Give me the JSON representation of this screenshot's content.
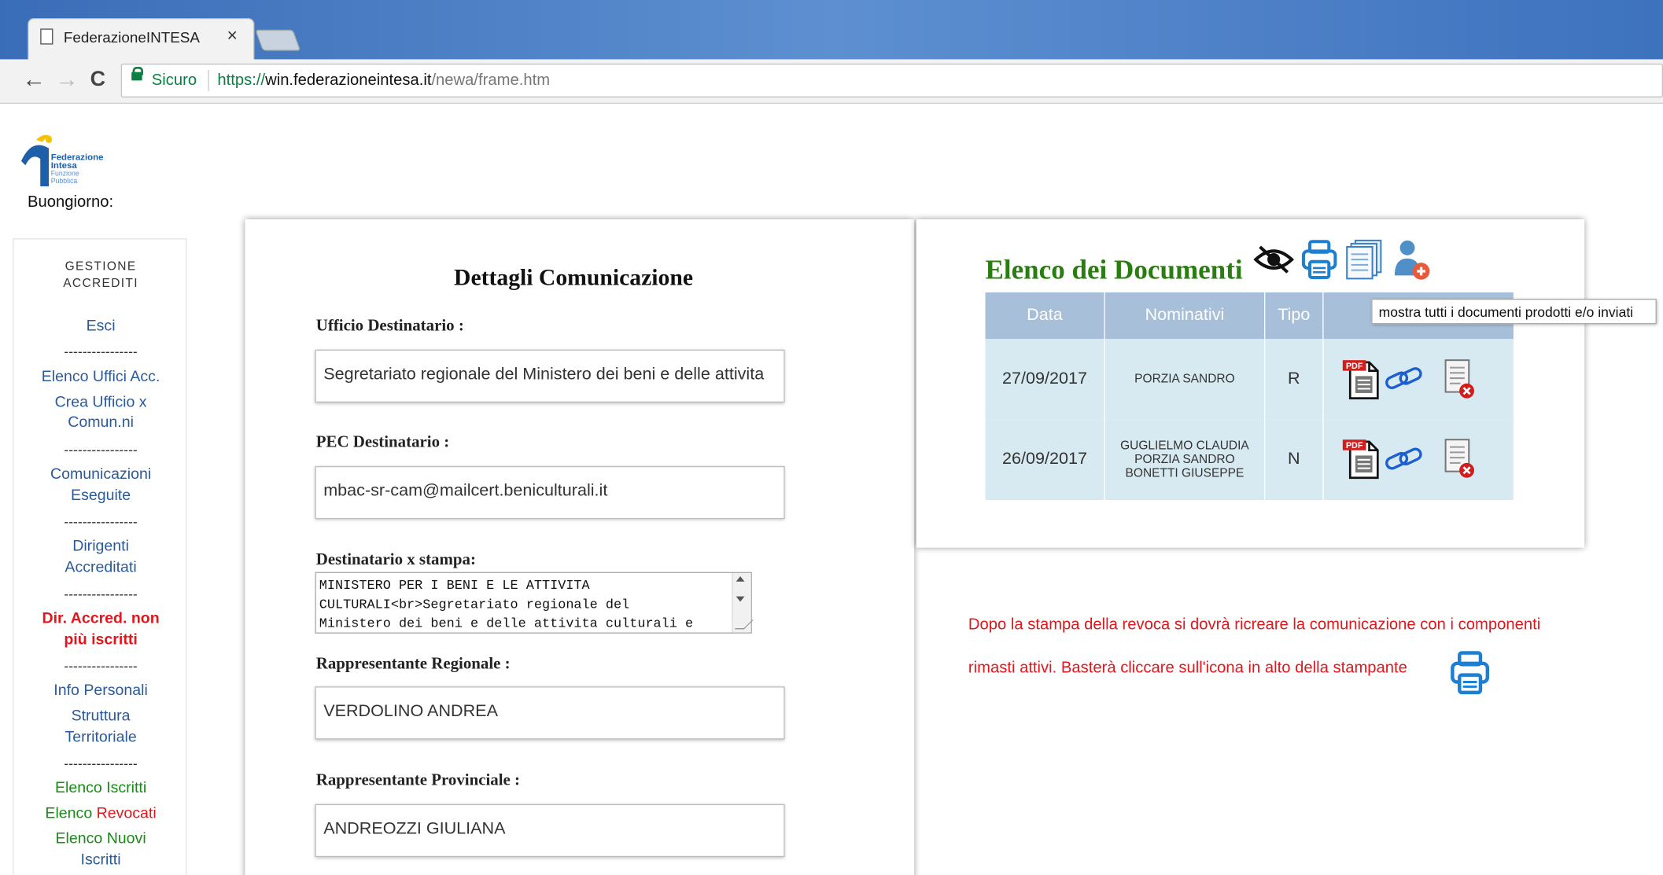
{
  "browser": {
    "tab_title": "FederazioneINTESA",
    "close_glyph": "×",
    "back_glyph": "←",
    "forward_glyph": "→",
    "reload_glyph": "C",
    "secure_label": "Sicuro",
    "url_scheme": "https://",
    "url_host": "win.federazioneintesa.it",
    "url_path": "/newa/frame.htm"
  },
  "header": {
    "logo_line1": "Federazione",
    "logo_line2": "Intesa",
    "logo_line3": "Funzione",
    "logo_line4": "Pubblica",
    "greeting": "Buongiorno:"
  },
  "sidebar": {
    "heading": "GESTIONE ACCREDITI",
    "separator": "----------------",
    "items": [
      "Esci",
      "Elenco Uffici Acc.",
      "Crea Ufficio x Comun.ni",
      "Comunicazioni Eseguite",
      "Dirigenti Accreditati",
      "Dir. Accred. non più iscritti",
      "Info Personali",
      "Struttura Territoriale",
      "Elenco Iscritti",
      "Elenco",
      "Revocati",
      "Elenco Nuovi",
      "Iscritti"
    ]
  },
  "form": {
    "title": "Dettagli Comunicazione",
    "ufficio_label": "Ufficio Destinatario :",
    "ufficio_value": "Segretariato regionale del Ministero dei beni e delle attivita",
    "pec_label": "PEC Destinatario :",
    "pec_value": "mbac-sr-cam@mailcert.beniculturali.it",
    "stampa_label": "Destinatario x stampa:",
    "stampa_value": "MINISTERO PER I BENI E LE ATTIVITA\nCULTURALI<br>Segretariato regionale del\nMinistero dei beni e delle attivita culturali e",
    "regionale_label": "Rappresentante Regionale :",
    "regionale_value": "VERDOLINO ANDREA",
    "provinciale_label": "Rappresentante Provinciale :",
    "provinciale_value": "ANDREOZZI GIULIANA"
  },
  "documents": {
    "title": "Elenco dei Documenti",
    "columns": [
      "Data",
      "Nominativi",
      "Tipo",
      ""
    ],
    "rows": [
      {
        "date": "27/09/2017",
        "names": [
          "PORZIA SANDRO"
        ],
        "type": "R"
      },
      {
        "date": "26/09/2017",
        "names": [
          "GUGLIELMO CLAUDIA",
          "PORZIA SANDRO",
          "BONETTI GIUSEPPE"
        ],
        "type": "N"
      }
    ],
    "pdf_label": "PDF",
    "tooltip": "mostra tutti i documenti prodotti e/o inviati"
  },
  "note": {
    "line1": "Dopo la stampa della revoca si dovrà ricreare la comunicazione con i componenti",
    "line2": "rimasti attivi. Basterà cliccare sull'icona in alto della stampante"
  },
  "colors": {
    "doc_title": "#2a7d10",
    "alert_red": "#e3161c",
    "link_blue": "#2a5a9a",
    "table_header": "#a7bfd9",
    "table_cell": "#d8eaf1",
    "icon_blue": "#1d7fd1"
  }
}
